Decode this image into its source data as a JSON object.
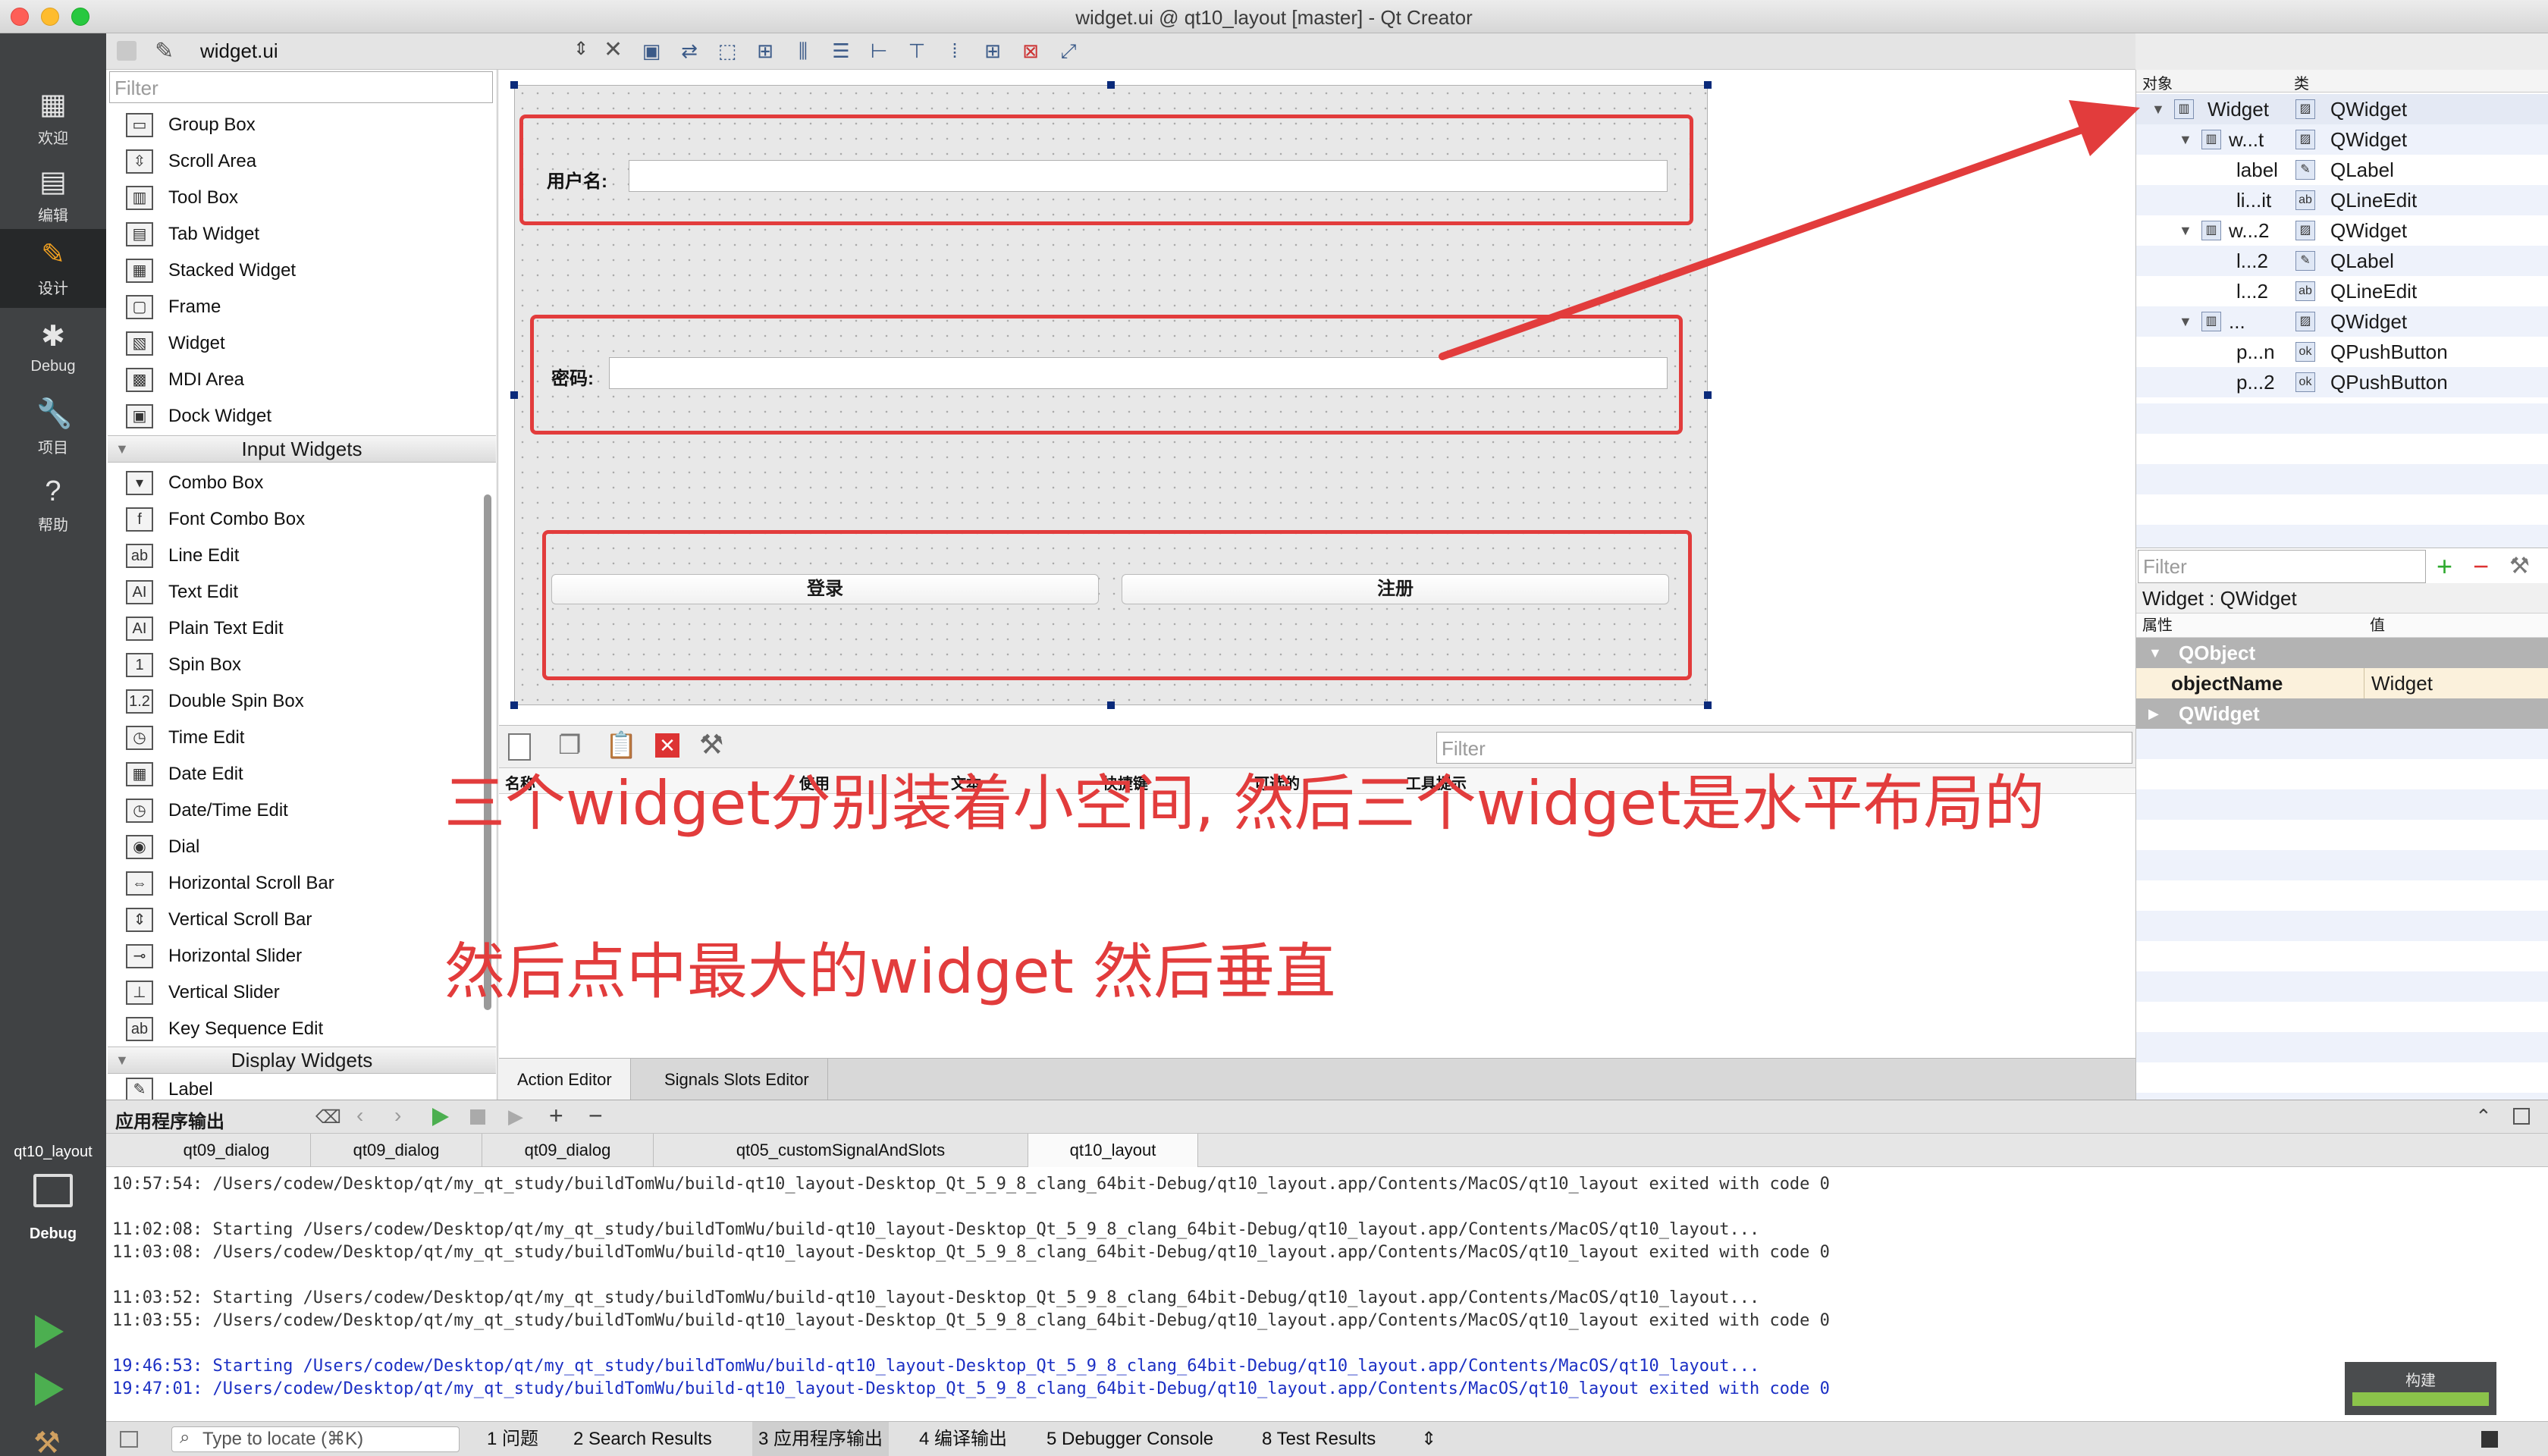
{
  "window": {
    "title": "widget.ui @ qt10_layout [master] - Qt Creator"
  },
  "modes": [
    {
      "label": "欢迎",
      "icon": "grid-icon"
    },
    {
      "label": "编辑",
      "icon": "edit-doc-icon"
    },
    {
      "label": "设计",
      "icon": "pencil-icon"
    },
    {
      "label": "Debug",
      "icon": "bug-icon"
    },
    {
      "label": "项目",
      "icon": "wrench-icon"
    },
    {
      "label": "帮助",
      "icon": "help-icon"
    }
  ],
  "kit": {
    "project": "qt10_layout",
    "config": "Debug"
  },
  "editor": {
    "file": "widget.ui"
  },
  "widgetbox": {
    "filter_placeholder": "Filter",
    "containers": [
      "Group Box",
      "Scroll Area",
      "Tool Box",
      "Tab Widget",
      "Stacked Widget",
      "Frame",
      "Widget",
      "MDI Area",
      "Dock Widget"
    ],
    "input_category": "Input Widgets",
    "inputs": [
      "Combo Box",
      "Font Combo Box",
      "Line Edit",
      "Text Edit",
      "Plain Text Edit",
      "Spin Box",
      "Double Spin Box",
      "Time Edit",
      "Date Edit",
      "Date/Time Edit",
      "Dial",
      "Horizontal Scroll Bar",
      "Vertical Scroll Bar",
      "Horizontal Slider",
      "Vertical Slider",
      "Key Sequence Edit"
    ],
    "display_category": "Display Widgets",
    "display_first": "Label"
  },
  "form": {
    "username_label": "用户名:",
    "password_label": "密码:",
    "login_button": "登录",
    "register_button": "注册"
  },
  "action_editor": {
    "filter_placeholder": "Filter",
    "columns": [
      "名称",
      "使用",
      "文本",
      "快捷键",
      "可选的",
      "工具提示"
    ],
    "tabs": [
      "Action Editor",
      "Signals  Slots Editor"
    ]
  },
  "object_inspector": {
    "col_object": "对象",
    "col_class": "类",
    "rows": [
      {
        "name": "Widget",
        "cls": "QWidget"
      },
      {
        "name": "w...t",
        "cls": "QWidget"
      },
      {
        "name": "label",
        "cls": "QLabel"
      },
      {
        "name": "li...it",
        "cls": "QLineEdit"
      },
      {
        "name": "w...2",
        "cls": "QWidget"
      },
      {
        "name": "l...2",
        "cls": "QLabel"
      },
      {
        "name": "l...2",
        "cls": "QLineEdit"
      },
      {
        "name": "...",
        "cls": "QWidget"
      },
      {
        "name": "p...n",
        "cls": "QPushButton"
      },
      {
        "name": "p...2",
        "cls": "QPushButton"
      }
    ]
  },
  "property_editor": {
    "filter_placeholder": "Filter",
    "title": "Widget : QWidget",
    "col_prop": "属性",
    "col_value": "值",
    "group1": "QObject",
    "prop_name": "objectName",
    "prop_value": "Widget",
    "group2": "QWidget"
  },
  "output": {
    "title": "应用程序输出",
    "tabs": [
      "qt09_dialog",
      "qt09_dialog",
      "qt09_dialog",
      "qt05_customSignalAndSlots",
      "qt10_layout"
    ],
    "lines": [
      "10:57:54: /Users/codew/Desktop/qt/my_qt_study/buildTomWu/build-qt10_layout-Desktop_Qt_5_9_8_clang_64bit-Debug/qt10_layout.app/Contents/MacOS/qt10_layout exited with code 0",
      "",
      "11:02:08: Starting /Users/codew/Desktop/qt/my_qt_study/buildTomWu/build-qt10_layout-Desktop_Qt_5_9_8_clang_64bit-Debug/qt10_layout.app/Contents/MacOS/qt10_layout...",
      "11:03:08: /Users/codew/Desktop/qt/my_qt_study/buildTomWu/build-qt10_layout-Desktop_Qt_5_9_8_clang_64bit-Debug/qt10_layout.app/Contents/MacOS/qt10_layout exited with code 0",
      "",
      "11:03:52: Starting /Users/codew/Desktop/qt/my_qt_study/buildTomWu/build-qt10_layout-Desktop_Qt_5_9_8_clang_64bit-Debug/qt10_layout.app/Contents/MacOS/qt10_layout...",
      "11:03:55: /Users/codew/Desktop/qt/my_qt_study/buildTomWu/build-qt10_layout-Desktop_Qt_5_9_8_clang_64bit-Debug/qt10_layout.app/Contents/MacOS/qt10_layout exited with code 0",
      "",
      "19:46:53: Starting /Users/codew/Desktop/qt/my_qt_study/buildTomWu/build-qt10_layout-Desktop_Qt_5_9_8_clang_64bit-Debug/qt10_layout.app/Contents/MacOS/qt10_layout...",
      "19:47:01: /Users/codew/Desktop/qt/my_qt_study/buildTomWu/build-qt10_layout-Desktop_Qt_5_9_8_clang_64bit-Debug/qt10_layout.app/Contents/MacOS/qt10_layout exited with code 0"
    ]
  },
  "statusbar": {
    "locate_placeholder": "Type to locate (⌘K)",
    "tabs": [
      "1  问题",
      "2  Search Results",
      "3  应用程序输出",
      "4  编译输出",
      "5  Debugger Console",
      "8  Test Results"
    ]
  },
  "build_label": "构建",
  "annotations": {
    "line1": "三个widget分别装着小空间, 然后三个widget是水平布局的",
    "line2": "然后点中最大的widget 然后垂直"
  },
  "colors": {
    "annotation": "#e23c3c",
    "modebar": "#404244",
    "log_blue": "#1b2fc4"
  }
}
